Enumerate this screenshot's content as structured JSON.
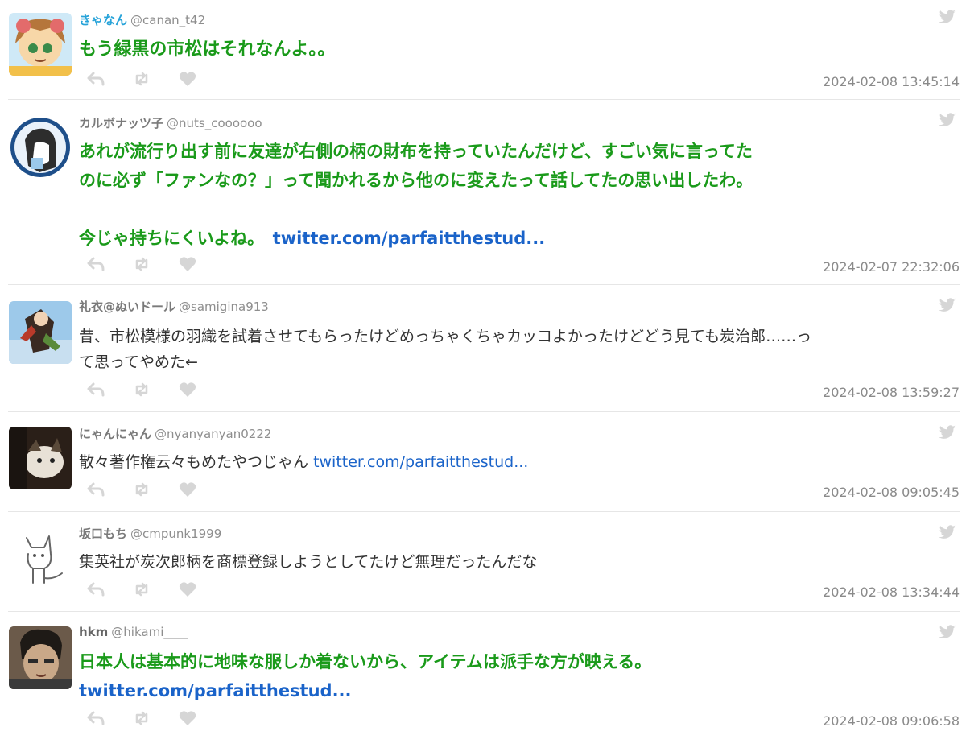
{
  "tweets": [
    {
      "name": "きゃなん",
      "handle": "@canan_t42",
      "text": "もう緑黒の市松はそれなんよ。。",
      "link": "",
      "time": "2024-02-08 13:45:14"
    },
    {
      "name": "カルボナッツ子",
      "handle": "@nuts_coooooo",
      "text_line1": "あれが流行り出す前に友達が右側の柄の財布を持っていたんだけど、すごい気に言ってた",
      "text_line2": "のに必ず「ファンなの？」って聞かれるから他のに変えたって話してたの思い出したわ。",
      "text_line3": "今じゃ持ちにくいよね。",
      "link": "twitter.com/parfaitthestud...",
      "time": "2024-02-07 22:32:06"
    },
    {
      "name": "礼衣@ぬいドール",
      "handle": "@samigina913",
      "text_line1": "昔、市松模様の羽織を試着させてもらったけどめっちゃくちゃカッコよかったけどどう見ても炭治郎……っ",
      "text_line2": "て思ってやめた←",
      "time": "2024-02-08 13:59:27"
    },
    {
      "name": "にゃんにゃん",
      "handle": "@nyanyanyan0222",
      "text": "散々著作権云々もめたやつじゃん",
      "link": "twitter.com/parfaitthestud...",
      "time": "2024-02-08 09:05:45"
    },
    {
      "name": "坂口もち",
      "handle": "@cmpunk1999",
      "text": "集英社が炭次郎柄を商標登録しようとしてたけど無理だったんだな",
      "time": "2024-02-08 13:34:44"
    },
    {
      "name": "hkm",
      "handle": "@hikami____",
      "text": "日本人は基本的に地味な服しか着ないから、アイテムは派手な方が映える。",
      "link": "twitter.com/parfaitthestud...",
      "time": "2024-02-08 09:06:58"
    }
  ],
  "colors": {
    "accent_green": "#1a9a1a",
    "link_blue": "#1a63c9",
    "name_blue": "#27a3d9",
    "icon_gray": "#d6d6d6"
  },
  "icons": [
    "reply-icon",
    "retweet-icon",
    "like-icon",
    "twitter-bird-icon"
  ]
}
